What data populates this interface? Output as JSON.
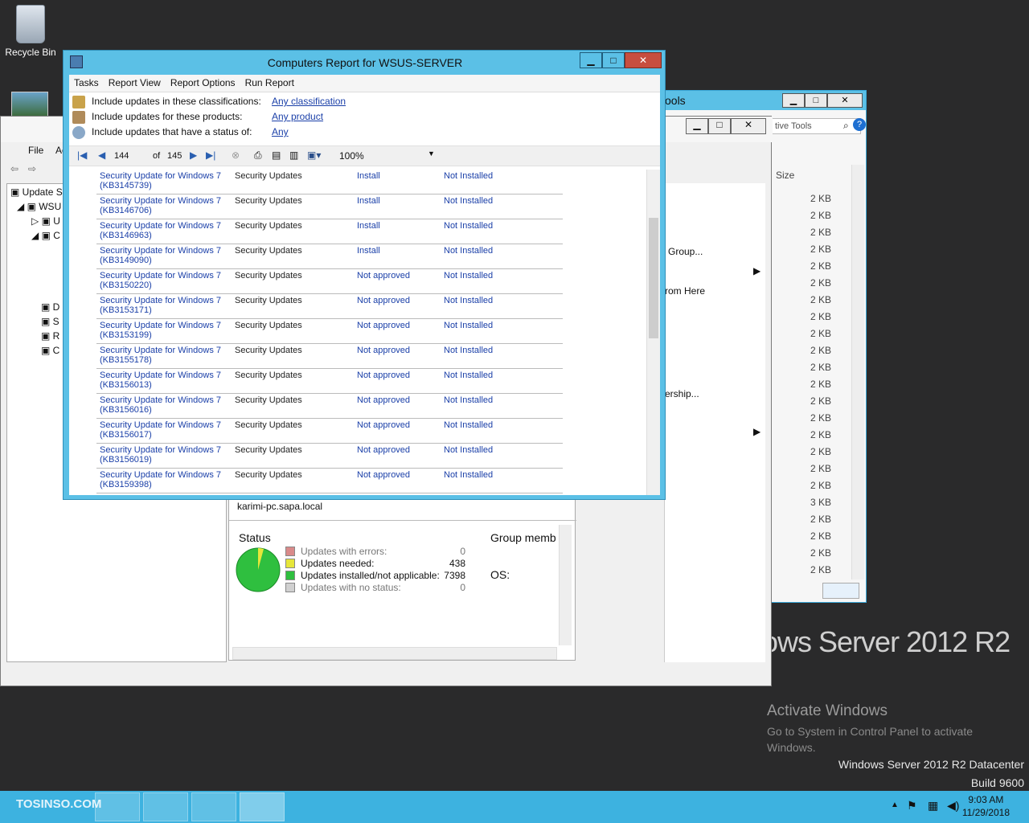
{
  "desktop": {
    "recycle_bin": "Recycle Bin",
    "watermark_title": "ows Server 2012 R2",
    "activate_title": "Activate Windows",
    "activate_sub": "Go to System in Control Panel to activate Windows.",
    "edition": "Windows Server 2012 R2 Datacenter",
    "build": "Build 9600"
  },
  "back_window": {
    "title_fragment": "ools",
    "search_placeholder": "tive Tools",
    "size_header": "Size",
    "sizes": [
      "2 KB",
      "2 KB",
      "2 KB",
      "2 KB",
      "2 KB",
      "2 KB",
      "2 KB",
      "2 KB",
      "2 KB",
      "2 KB",
      "2 KB",
      "2 KB",
      "2 KB",
      "2 KB",
      "2 KB",
      "2 KB",
      "2 KB",
      "2 KB",
      "3 KB",
      "2 KB",
      "2 KB",
      "2 KB",
      "2 KB"
    ]
  },
  "mmc": {
    "menu": [
      "File",
      "Ac"
    ],
    "tree": [
      "Update S",
      "WSU",
      "U",
      "C",
      "D",
      "S",
      "R",
      "C"
    ],
    "actions": [
      "Group...",
      "rom Here",
      "ership..."
    ],
    "detail": {
      "computer": "karimi-pc.sapa.local",
      "status_title": "Status",
      "group_title": "Group memb",
      "os_label": "OS:",
      "legend": [
        {
          "label": "Updates with errors:",
          "value": "0",
          "color": "#d98a8a"
        },
        {
          "label": "Updates needed:",
          "value": "438",
          "color": "#e6e63a"
        },
        {
          "label": "Updates installed/not applicable:",
          "value": "7398",
          "color": "#2fbf3f"
        },
        {
          "label": "Updates with no status:",
          "value": "0",
          "color": "#d0d0d0"
        }
      ]
    }
  },
  "report": {
    "title": "Computers Report for WSUS-SERVER",
    "menu": [
      "Tasks",
      "Report View",
      "Report Options",
      "Run Report"
    ],
    "criteria": [
      {
        "label": "Include updates in these classifications:",
        "link": "Any classification"
      },
      {
        "label": "Include updates for these products:",
        "link": "Any product"
      },
      {
        "label": "Include updates that have a status of:",
        "link": "Any"
      }
    ],
    "page": "144",
    "of_label": "of",
    "total_pages": "145",
    "zoom": "100%",
    "rows": [
      {
        "title": "Security Update for Windows 7",
        "kb": "(KB3145739)",
        "classification": "Security Updates",
        "approval": "Install",
        "status": "Not Installed"
      },
      {
        "title": "Security Update for Windows 7",
        "kb": "(KB3146706)",
        "classification": "Security Updates",
        "approval": "Install",
        "status": "Not Installed"
      },
      {
        "title": "Security Update for Windows 7",
        "kb": "(KB3146963)",
        "classification": "Security Updates",
        "approval": "Install",
        "status": "Not Installed"
      },
      {
        "title": "Security Update for Windows 7",
        "kb": "(KB3149090)",
        "classification": "Security Updates",
        "approval": "Install",
        "status": "Not Installed"
      },
      {
        "title": "Security Update for Windows 7",
        "kb": "(KB3150220)",
        "classification": "Security Updates",
        "approval": "Not approved",
        "status": "Not Installed"
      },
      {
        "title": "Security Update for Windows 7",
        "kb": "(KB3153171)",
        "classification": "Security Updates",
        "approval": "Not approved",
        "status": "Not Installed"
      },
      {
        "title": "Security Update for Windows 7",
        "kb": "(KB3153199)",
        "classification": "Security Updates",
        "approval": "Not approved",
        "status": "Not Installed"
      },
      {
        "title": "Security Update for Windows 7",
        "kb": "(KB3155178)",
        "classification": "Security Updates",
        "approval": "Not approved",
        "status": "Not Installed"
      },
      {
        "title": "Security Update for Windows 7",
        "kb": "(KB3156013)",
        "classification": "Security Updates",
        "approval": "Not approved",
        "status": "Not Installed"
      },
      {
        "title": "Security Update for Windows 7",
        "kb": "(KB3156016)",
        "classification": "Security Updates",
        "approval": "Not approved",
        "status": "Not Installed"
      },
      {
        "title": "Security Update for Windows 7",
        "kb": "(KB3156017)",
        "classification": "Security Updates",
        "approval": "Not approved",
        "status": "Not Installed"
      },
      {
        "title": "Security Update for Windows 7",
        "kb": "(KB3156019)",
        "classification": "Security Updates",
        "approval": "Not approved",
        "status": "Not Installed"
      },
      {
        "title": "Security Update for Windows 7",
        "kb": "(KB3159398)",
        "classification": "Security Updates",
        "approval": "Not approved",
        "status": "Not Installed"
      }
    ]
  },
  "taskbar": {
    "watermark": "TOSINSO.COM",
    "time": "9:03 AM",
    "date": "11/29/2018"
  }
}
